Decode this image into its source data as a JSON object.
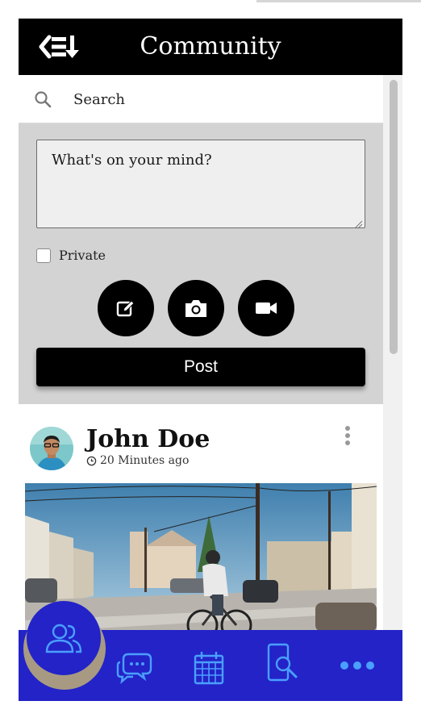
{
  "header": {
    "title": "Community",
    "menu_icon": "collapse-menu-icon"
  },
  "search": {
    "placeholder": "Search",
    "icon": "search-icon"
  },
  "composer": {
    "placeholder": "What's on your mind?",
    "private_label": "Private",
    "private_checked": false,
    "actions": [
      "edit-icon",
      "camera-icon",
      "video-icon"
    ],
    "post_label": "Post"
  },
  "post": {
    "author": "John Doe",
    "time": "20 Minutes ago",
    "time_icon": "clock-icon",
    "menu_icon": "more-vertical-icon"
  },
  "bottom_nav": {
    "items": [
      "community-icon",
      "chat-icon",
      "calendar-icon",
      "search-phone-icon",
      "more-icon"
    ]
  },
  "colors": {
    "header_bg": "#000000",
    "compose_bg": "#d3d3d3",
    "nav_bg": "#2323c8",
    "icon_color": "#4a9fff"
  }
}
